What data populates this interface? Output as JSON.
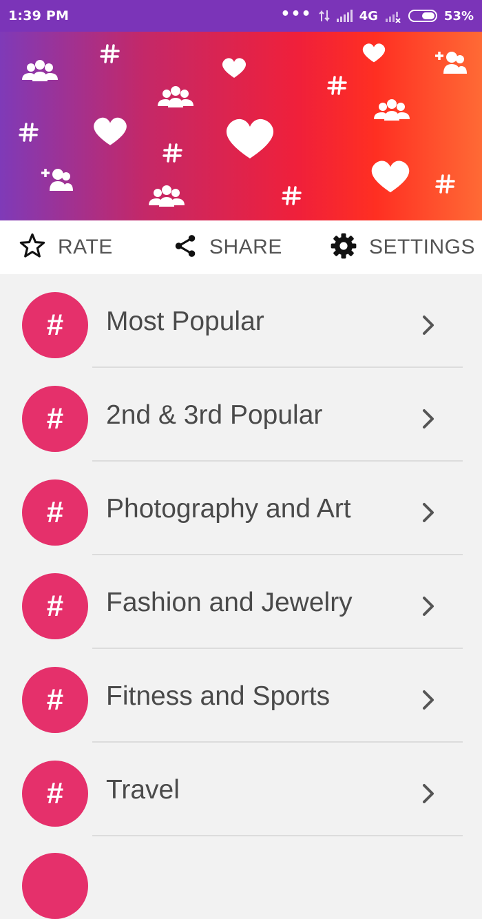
{
  "status_bar": {
    "time": "1:39 PM",
    "dots": "•••",
    "network": "4G",
    "battery_percent": "53%",
    "battery_level": 0.53
  },
  "banner": {
    "colors": [
      "#7f3ab8",
      "#c42868",
      "#f0203a",
      "#ff2f22",
      "#ff6a35"
    ],
    "decorations": [
      "group-icon",
      "hashtag-icon",
      "heart-icon",
      "add-user-icon"
    ]
  },
  "actions": {
    "rate": {
      "label": "RATE",
      "icon": "star-outline-icon"
    },
    "share": {
      "label": "SHARE",
      "icon": "share-icon"
    },
    "settings": {
      "label": "SETTINGS",
      "icon": "gear-icon"
    }
  },
  "categories": {
    "icon_glyph": "#",
    "accent": "#e5306b",
    "items": [
      {
        "label": "Most Popular"
      },
      {
        "label": "2nd & 3rd Popular"
      },
      {
        "label": "Photography and Art"
      },
      {
        "label": "Fashion and Jewelry"
      },
      {
        "label": "Fitness and Sports"
      },
      {
        "label": "Travel"
      }
    ]
  }
}
